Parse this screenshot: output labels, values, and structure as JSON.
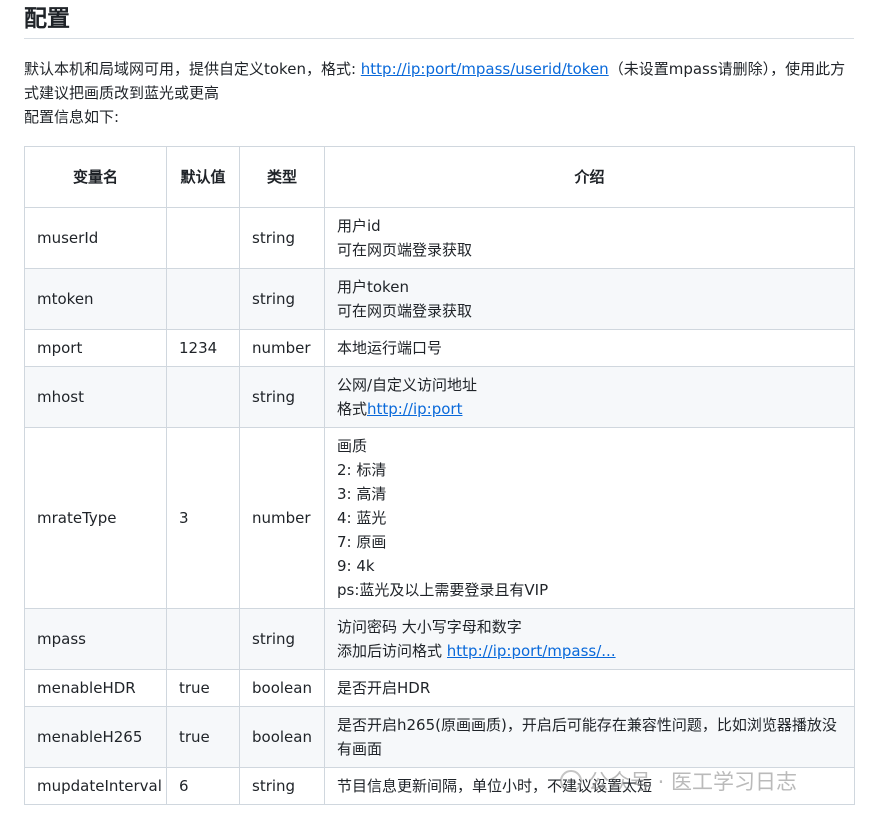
{
  "heading": "配置",
  "intro": {
    "before_link": "默认本机和局域网可用，提供自定义token，格式: ",
    "link": "http://ip:port/mpass/userid/token",
    "after_link": "（未设置mpass请删除），使用此方式建议把画质改到蓝光或更高",
    "line2": "配置信息如下:"
  },
  "table": {
    "headers": [
      "变量名",
      "默认值",
      "类型",
      "介绍"
    ],
    "rows": [
      {
        "name": "muserId",
        "default": "",
        "type": "string",
        "desc": [
          "用户id",
          "可在网页端登录获取"
        ]
      },
      {
        "name": "mtoken",
        "default": "",
        "type": "string",
        "desc": [
          "用户token",
          "可在网页端登录获取"
        ]
      },
      {
        "name": "mport",
        "default": "1234",
        "type": "number",
        "desc": [
          "本地运行端口号"
        ]
      },
      {
        "name": "mhost",
        "default": "",
        "type": "string",
        "desc_prefix": "公网/自定义访问地址",
        "desc_label": "格式",
        "desc_link": "http://ip:port"
      },
      {
        "name": "mrateType",
        "default": "3",
        "type": "number",
        "desc": [
          "画质",
          "2: 标清",
          "3: 高清",
          "4: 蓝光",
          "7: 原画",
          "9: 4k",
          "ps:蓝光及以上需要登录且有VIP"
        ]
      },
      {
        "name": "mpass",
        "default": "",
        "type": "string",
        "desc_line1": "访问密码 大小写字母和数字",
        "desc_label": "添加后访问格式 ",
        "desc_link": "http://ip:port/mpass/..."
      },
      {
        "name": "menableHDR",
        "default": "true",
        "type": "boolean",
        "desc": [
          "是否开启HDR"
        ]
      },
      {
        "name": "menableH265",
        "default": "true",
        "type": "boolean",
        "desc_wrap": "是否开启h265(原画画质)，开启后可能存在兼容性问题，比如浏览器播放没有画面"
      },
      {
        "name": "mupdateInterval",
        "default": "6",
        "type": "string",
        "desc": [
          "节目信息更新间隔，单位小时，不建议设置太短"
        ]
      }
    ]
  },
  "watermark": {
    "dot": "·",
    "text": "公众号 · 医工学习日志"
  }
}
